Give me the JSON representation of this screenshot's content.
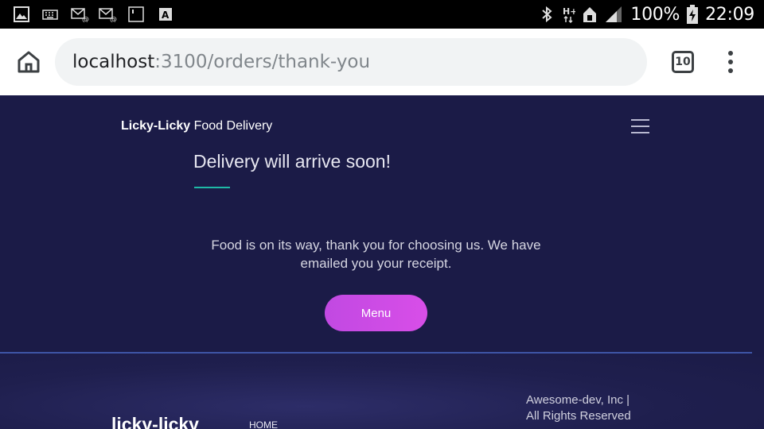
{
  "status_bar": {
    "battery": "100%",
    "time": "22:09"
  },
  "browser": {
    "url_host": "localhost",
    "url_path": ":3100/orders/thank-you",
    "tab_count": "10"
  },
  "header": {
    "brand_bold": "Licky-Licky",
    "brand_rest": " Food Delivery"
  },
  "main": {
    "title": "Delivery will arrive soon!",
    "message": "Food is on its way, thank you for choosing us. We have emailed you your receipt.",
    "menu_button": "Menu",
    "accent_color": "#1fb9a6",
    "button_color": "#d04ce6"
  },
  "footer": {
    "logo": "licky-licky",
    "nav": [
      "HOME"
    ],
    "copyright": "Awesome-dev, Inc | All Rights Reserved"
  }
}
